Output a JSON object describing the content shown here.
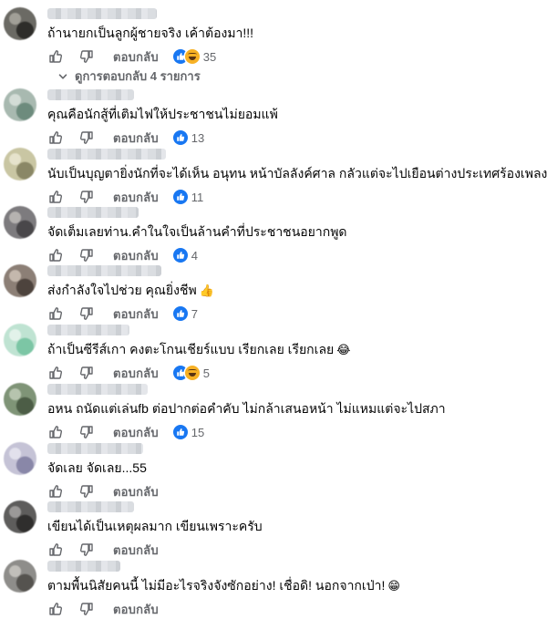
{
  "reply_label": "ตอบกลับ",
  "view_replies_label": "ดูการตอบกลับ 4 รายการ",
  "comments": [
    {
      "text": "ถ้านายกเป็นลูกผู้ชายจริง เค้าต้องมา!!!",
      "emoji": "",
      "reactions": [
        "like",
        "haha"
      ],
      "count": "35"
    },
    {
      "text": "คุณคือนักสู้ที่เติมไฟให้ประชาชนไม่ยอมแพ้",
      "emoji": "",
      "reactions": [
        "like"
      ],
      "count": "13"
    },
    {
      "text": "นับเป็นบุญตายิ่งนักที่จะได้เห็น อนุทน หน้าบัลลังค์ศาล กลัวแต่จะไปเยือนต่างประเทศร้องเพลงโชว์",
      "emoji": "",
      "reactions": [
        "like"
      ],
      "count": "11"
    },
    {
      "text": "จัดเต็มเลยท่าน.คำในใจเป็นล้านคำที่ประชาชนอยากพูด",
      "emoji": "",
      "reactions": [
        "like"
      ],
      "count": "4"
    },
    {
      "text": "ส่งกำลังใจไปช่วย คุณยิ่งชีพ",
      "emoji": "👍",
      "reactions": [
        "like"
      ],
      "count": "7"
    },
    {
      "text": "ถ้าเป็นซีรีส์เกา คงตะโกนเชียร์แบบ เรียกเลย เรียกเลย",
      "emoji": "😂",
      "reactions": [
        "like",
        "haha"
      ],
      "count": "5"
    },
    {
      "text": "อหน ถนัดแต่เล่นfb ต่อปากต่อคำคับ ไม่กล้าเสนอหน้า ไม่แหมแต่จะไปสภา",
      "emoji": "",
      "reactions": [
        "like"
      ],
      "count": "15"
    },
    {
      "text": "จัดเลย จัดเลย...55",
      "emoji": "",
      "reactions": [],
      "count": ""
    },
    {
      "text": "เขียนได้เป็นเหตุผลมาก เขียนเพราะครับ",
      "emoji": "",
      "reactions": [],
      "count": ""
    },
    {
      "text": "ตามพื้นนิสัยคนนี้ ไม่มีอะไรจริงจังซักอย่าง! เชื่อดิ! นอกจากเป่า!",
      "emoji": "😁",
      "reactions": [],
      "count": ""
    }
  ],
  "colors": {
    "like_blue": "#1877f2",
    "muted_text": "#65676b",
    "haha_yellow": "#f7b125"
  },
  "icons": [
    "thumbs-up-icon",
    "thumbs-down-icon",
    "chevron-down-icon"
  ]
}
